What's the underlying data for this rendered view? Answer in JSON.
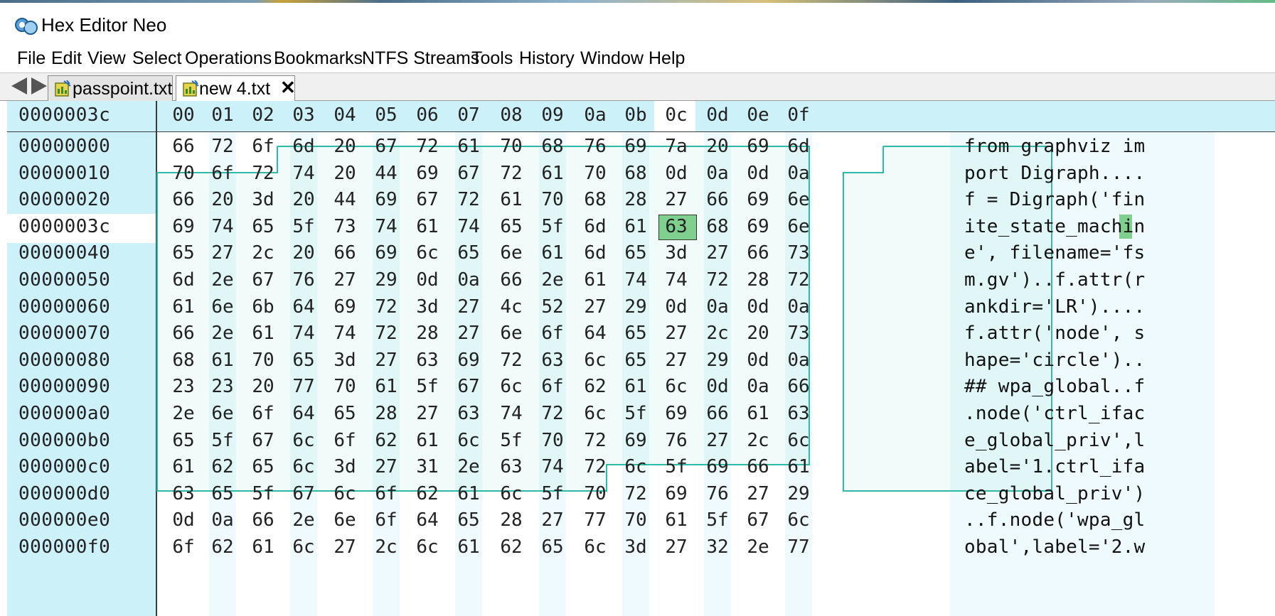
{
  "window": {
    "title": "Hex Editor Neo"
  },
  "menu": [
    "File",
    "Edit",
    "View",
    "Select",
    "Operations",
    "Bookmarks",
    "NTFS Streams",
    "Tools",
    "History",
    "Window",
    "Help"
  ],
  "tabs": [
    {
      "label": "passpoint.txt",
      "active": false
    },
    {
      "label": "new 4.txt",
      "active": true
    }
  ],
  "tab_close_glyph": "✕",
  "editor": {
    "current_offset": "0000003c",
    "column_headers": [
      "00",
      "01",
      "02",
      "03",
      "04",
      "05",
      "06",
      "07",
      "08",
      "09",
      "0a",
      "0b",
      "0c",
      "0d",
      "0e",
      "0f"
    ],
    "current_column": 12,
    "current_row": 3,
    "rows": [
      {
        "addr": "00000000",
        "bytes": [
          "66",
          "72",
          "6f",
          "6d",
          "20",
          "67",
          "72",
          "61",
          "70",
          "68",
          "76",
          "69",
          "7a",
          "20",
          "69",
          "6d"
        ],
        "ascii": "from graphviz im"
      },
      {
        "addr": "00000010",
        "bytes": [
          "70",
          "6f",
          "72",
          "74",
          "20",
          "44",
          "69",
          "67",
          "72",
          "61",
          "70",
          "68",
          "0d",
          "0a",
          "0d",
          "0a"
        ],
        "ascii": "port Digraph...."
      },
      {
        "addr": "00000020",
        "bytes": [
          "66",
          "20",
          "3d",
          "20",
          "44",
          "69",
          "67",
          "72",
          "61",
          "70",
          "68",
          "28",
          "27",
          "66",
          "69",
          "6e"
        ],
        "ascii": "f = Digraph('fin"
      },
      {
        "addr": "0000003c",
        "bytes": [
          "69",
          "74",
          "65",
          "5f",
          "73",
          "74",
          "61",
          "74",
          "65",
          "5f",
          "6d",
          "61",
          "63",
          "68",
          "69",
          "6e"
        ],
        "ascii": "ite_state_machin"
      },
      {
        "addr": "00000040",
        "bytes": [
          "65",
          "27",
          "2c",
          "20",
          "66",
          "69",
          "6c",
          "65",
          "6e",
          "61",
          "6d",
          "65",
          "3d",
          "27",
          "66",
          "73"
        ],
        "ascii": "e', filename='fs"
      },
      {
        "addr": "00000050",
        "bytes": [
          "6d",
          "2e",
          "67",
          "76",
          "27",
          "29",
          "0d",
          "0a",
          "66",
          "2e",
          "61",
          "74",
          "74",
          "72",
          "28",
          "72"
        ],
        "ascii": "m.gv')..f.attr(r"
      },
      {
        "addr": "00000060",
        "bytes": [
          "61",
          "6e",
          "6b",
          "64",
          "69",
          "72",
          "3d",
          "27",
          "4c",
          "52",
          "27",
          "29",
          "0d",
          "0a",
          "0d",
          "0a"
        ],
        "ascii": "ankdir='LR')...."
      },
      {
        "addr": "00000070",
        "bytes": [
          "66",
          "2e",
          "61",
          "74",
          "74",
          "72",
          "28",
          "27",
          "6e",
          "6f",
          "64",
          "65",
          "27",
          "2c",
          "20",
          "73"
        ],
        "ascii": "f.attr('node', s"
      },
      {
        "addr": "00000080",
        "bytes": [
          "68",
          "61",
          "70",
          "65",
          "3d",
          "27",
          "63",
          "69",
          "72",
          "63",
          "6c",
          "65",
          "27",
          "29",
          "0d",
          "0a"
        ],
        "ascii": "hape='circle').."
      },
      {
        "addr": "00000090",
        "bytes": [
          "23",
          "23",
          "20",
          "77",
          "70",
          "61",
          "5f",
          "67",
          "6c",
          "6f",
          "62",
          "61",
          "6c",
          "0d",
          "0a",
          "66"
        ],
        "ascii": "## wpa_global..f"
      },
      {
        "addr": "000000a0",
        "bytes": [
          "2e",
          "6e",
          "6f",
          "64",
          "65",
          "28",
          "27",
          "63",
          "74",
          "72",
          "6c",
          "5f",
          "69",
          "66",
          "61",
          "63"
        ],
        "ascii": ".node('ctrl_ifac"
      },
      {
        "addr": "000000b0",
        "bytes": [
          "65",
          "5f",
          "67",
          "6c",
          "6f",
          "62",
          "61",
          "6c",
          "5f",
          "70",
          "72",
          "69",
          "76",
          "27",
          "2c",
          "6c"
        ],
        "ascii": "e_global_priv',l"
      },
      {
        "addr": "000000c0",
        "bytes": [
          "61",
          "62",
          "65",
          "6c",
          "3d",
          "27",
          "31",
          "2e",
          "63",
          "74",
          "72",
          "6c",
          "5f",
          "69",
          "66",
          "61"
        ],
        "ascii": "abel='1.ctrl_ifa"
      },
      {
        "addr": "000000d0",
        "bytes": [
          "63",
          "65",
          "5f",
          "67",
          "6c",
          "6f",
          "62",
          "61",
          "6c",
          "5f",
          "70",
          "72",
          "69",
          "76",
          "27",
          "29"
        ],
        "ascii": "ce_global_priv')"
      },
      {
        "addr": "000000e0",
        "bytes": [
          "0d",
          "0a",
          "66",
          "2e",
          "6e",
          "6f",
          "64",
          "65",
          "28",
          "27",
          "77",
          "70",
          "61",
          "5f",
          "67",
          "6c"
        ],
        "ascii": "..f.node('wpa_gl"
      },
      {
        "addr": "000000f0",
        "bytes": [
          "6f",
          "62",
          "61",
          "6c",
          "27",
          "2c",
          "6c",
          "61",
          "62",
          "65",
          "6c",
          "3d",
          "27",
          "32",
          "2e",
          "77"
        ],
        "ascii": "obal',label='2.w"
      }
    ]
  }
}
